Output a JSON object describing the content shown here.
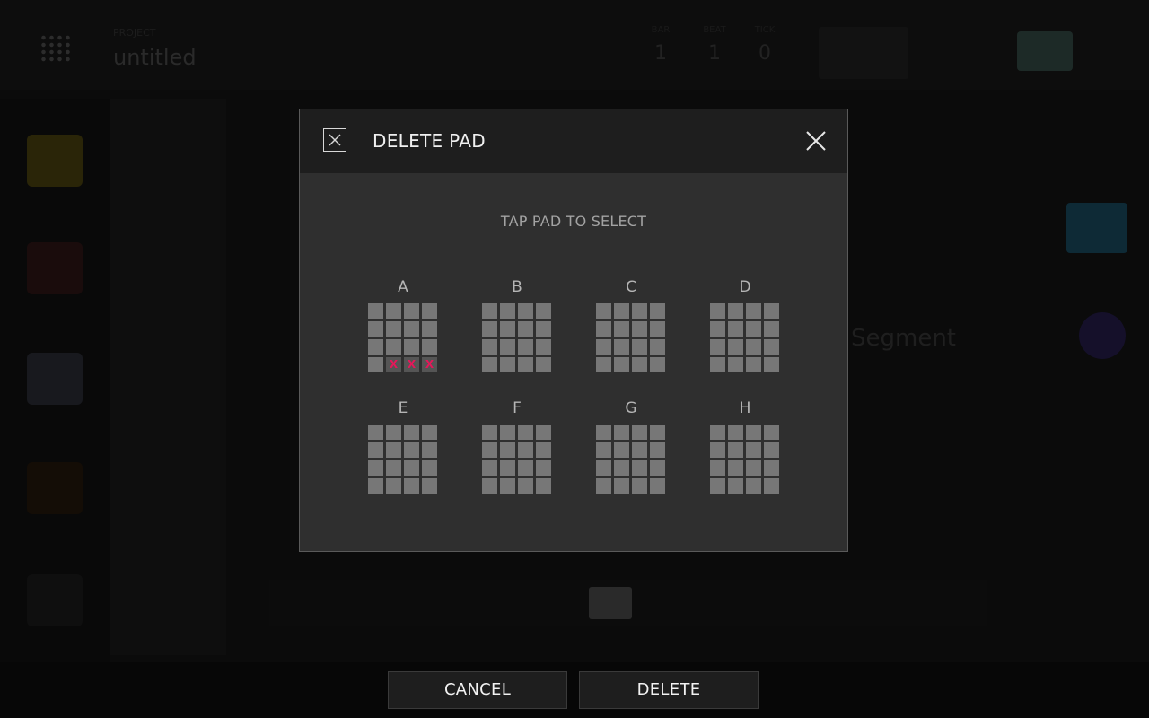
{
  "background": {
    "project_label": "PROJECT",
    "project_name": "untitled",
    "counters": [
      {
        "label": "BAR",
        "value": "1"
      },
      {
        "label": "BEAT",
        "value": "1"
      },
      {
        "label": "TICK",
        "value": "0"
      }
    ],
    "section_title": "Segment"
  },
  "dialog": {
    "title": "DELETE PAD",
    "instruction": "TAP PAD TO SELECT",
    "header_icon": "delete-pad-icon",
    "close_icon": "close-icon",
    "banks": [
      {
        "label": "A",
        "marked_pads": [
          13,
          14,
          15
        ]
      },
      {
        "label": "B",
        "marked_pads": []
      },
      {
        "label": "C",
        "marked_pads": []
      },
      {
        "label": "D",
        "marked_pads": []
      },
      {
        "label": "E",
        "marked_pads": []
      },
      {
        "label": "F",
        "marked_pads": []
      },
      {
        "label": "G",
        "marked_pads": []
      },
      {
        "label": "H",
        "marked_pads": []
      }
    ],
    "mark_symbol": "X",
    "mark_color": "#e4185a"
  },
  "buttons": {
    "cancel": "CANCEL",
    "delete": "DELETE"
  }
}
